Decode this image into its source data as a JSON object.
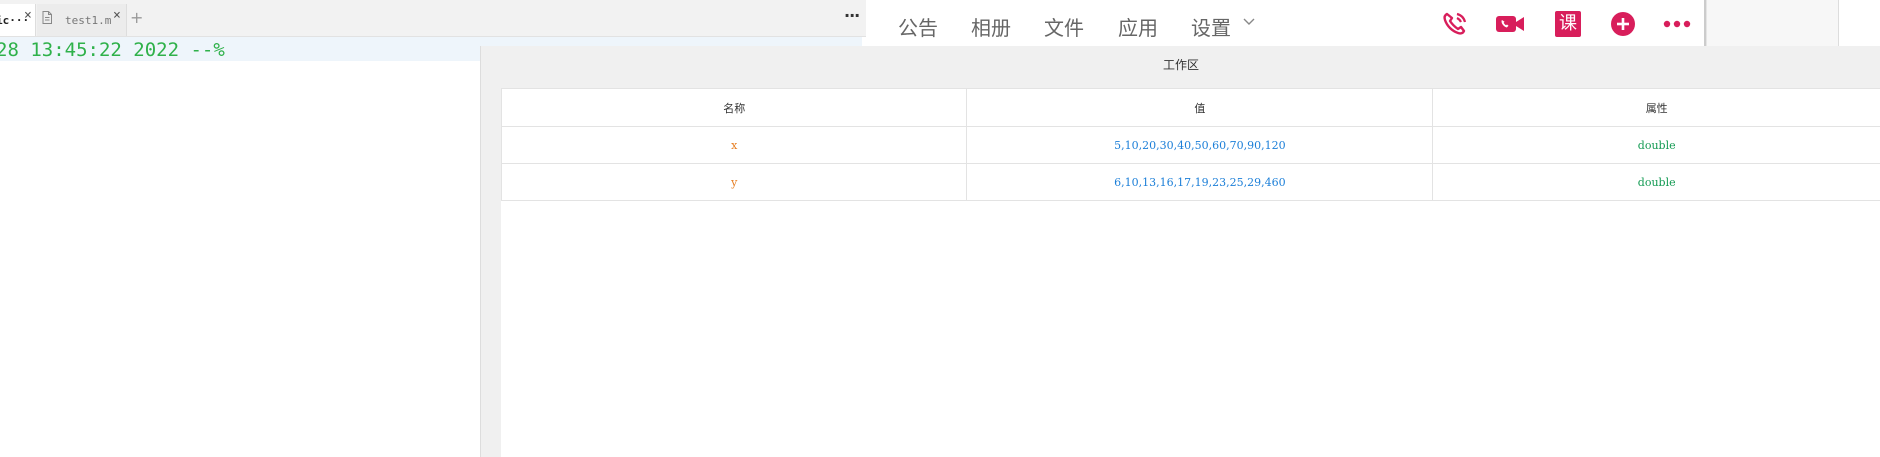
{
  "editor": {
    "tabs": [
      {
        "label": "ic···",
        "close": "×",
        "icon": "file-icon"
      },
      {
        "label": "test1.m",
        "close": "×",
        "icon": "file-icon"
      }
    ],
    "add_tab": "+",
    "more": "···",
    "code_line": "28 13:45:22 2022 --%"
  },
  "chat_toolbar": {
    "nav": [
      "公告",
      "相册",
      "文件",
      "应用",
      "设置"
    ],
    "actions": [
      "phone-icon",
      "video-call-icon",
      "class-icon",
      "add-icon",
      "more-icon"
    ],
    "class_label": "课",
    "accent_color": "#d81e5b"
  },
  "workspace": {
    "title": "工作区",
    "columns": [
      "名称",
      "值",
      "属性"
    ],
    "rows": [
      {
        "name": "x",
        "value": "5,10,20,30,40,50,60,70,90,120",
        "type": "double"
      },
      {
        "name": "y",
        "value": "6,10,13,16,17,19,23,25,29,460",
        "type": "double"
      }
    ],
    "colors": {
      "name": "#e67e22",
      "value": "#1c7fd8",
      "type": "#129a52"
    }
  }
}
